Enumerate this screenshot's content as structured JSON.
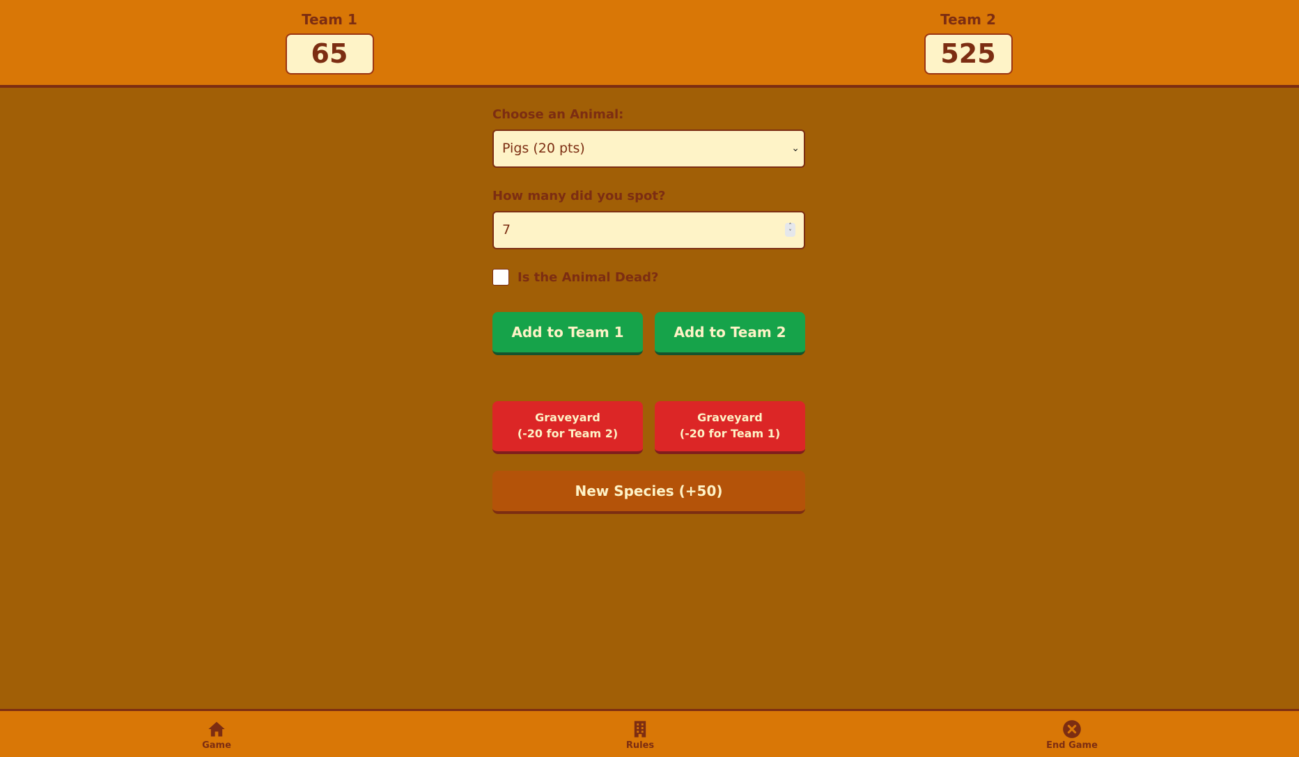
{
  "colors": {
    "header_bg": "#d97706",
    "page_bg": "#a15f06",
    "text_brown": "#7c2d12",
    "input_bg": "#fef3c7",
    "green_button": "#16a34a",
    "red_button": "#dc2626",
    "species_button": "#b45309"
  },
  "scoreboard": {
    "team1": {
      "name": "Team 1",
      "score": "65"
    },
    "team2": {
      "name": "Team 2",
      "score": "525"
    }
  },
  "form": {
    "animal_label": "Choose an Animal:",
    "animal_selected": "Pigs (20 pts)",
    "count_label": "How many did you spot?",
    "count_value": "7",
    "dead_label": "Is the Animal Dead?",
    "dead_checked": false
  },
  "buttons": {
    "add_team1": "Add to Team 1",
    "add_team2": "Add to Team 2",
    "graveyard_team2_line1": "Graveyard",
    "graveyard_team2_line2": "(-20 for Team 2)",
    "graveyard_team1_line1": "Graveyard",
    "graveyard_team1_line2": "(-20 for Team 1)",
    "new_species": "New Species (+50)"
  },
  "nav": {
    "items": [
      {
        "label": "Game",
        "icon": "home-icon"
      },
      {
        "label": "Rules",
        "icon": "building-icon"
      },
      {
        "label": "End Game",
        "icon": "close-circle-icon"
      }
    ]
  }
}
